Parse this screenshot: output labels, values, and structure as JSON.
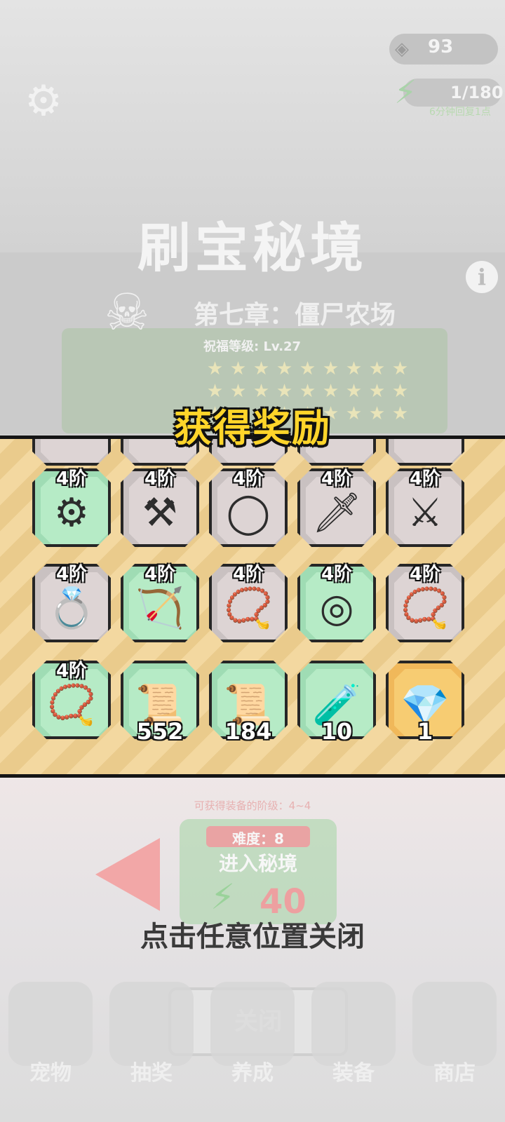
{
  "header": {
    "gems": "93",
    "energy": "1/180",
    "energy_regen": "6分钟回复1点",
    "title": "刷宝秘境",
    "chapter": "第七章：僵尸农场",
    "bless_level": "祝福等级: Lv.27"
  },
  "icons": {
    "settings": "gear-icon",
    "info": "info-icon",
    "gem": "gem-icon",
    "energy": "lightning-icon",
    "skull": "skull-icon"
  },
  "reward": {
    "banner": "获得奖励",
    "items": [
      {
        "tier": "4阶",
        "icon": "saw-chain-necklace-icon",
        "bg": "green",
        "qty": ""
      },
      {
        "tier": "4阶",
        "icon": "twin-axes-icon",
        "bg": "grey",
        "qty": ""
      },
      {
        "tier": "4阶",
        "icon": "water-ring-icon",
        "bg": "grey",
        "qty": ""
      },
      {
        "tier": "4阶",
        "icon": "broad-sword-icon",
        "bg": "grey",
        "qty": ""
      },
      {
        "tier": "4阶",
        "icon": "twin-katana-icon",
        "bg": "grey",
        "qty": ""
      },
      {
        "tier": "4阶",
        "icon": "crystal-ring-icon",
        "bg": "grey",
        "qty": ""
      },
      {
        "tier": "4阶",
        "icon": "crossbow-icon",
        "bg": "green",
        "qty": ""
      },
      {
        "tier": "4阶",
        "icon": "rope-necklace-icon",
        "bg": "grey",
        "qty": ""
      },
      {
        "tier": "4阶",
        "icon": "vine-ring-icon",
        "bg": "green",
        "qty": ""
      },
      {
        "tier": "4阶",
        "icon": "dark-necklace-icon",
        "bg": "grey",
        "qty": ""
      },
      {
        "tier": "4阶",
        "icon": "rope-necklace-icon",
        "bg": "green",
        "qty": ""
      },
      {
        "tier": "",
        "icon": "ring-scroll-icon",
        "bg": "green",
        "qty": "552"
      },
      {
        "tier": "",
        "icon": "weapon-scroll-icon",
        "bg": "green",
        "qty": "184"
      },
      {
        "tier": "",
        "icon": "potion-icon",
        "bg": "green",
        "qty": "10"
      },
      {
        "tier": "",
        "icon": "crystal-cluster-icon",
        "bg": "orange",
        "qty": "1"
      }
    ]
  },
  "lower": {
    "tier_range": "可获得装备的阶级：4~4",
    "difficulty": "难度：8",
    "enter": "进入秘境",
    "cost": "40",
    "close_hint": "点击任意位置关闭",
    "close_button": "关闭"
  },
  "nav": [
    {
      "label": "宠物",
      "icon": "egg-icon"
    },
    {
      "label": "抽奖",
      "icon": "chest-icon"
    },
    {
      "label": "养成",
      "icon": "upgrade-icon"
    },
    {
      "label": "装备",
      "icon": "sword-icon"
    },
    {
      "label": "商店",
      "icon": "shop-icon"
    }
  ]
}
